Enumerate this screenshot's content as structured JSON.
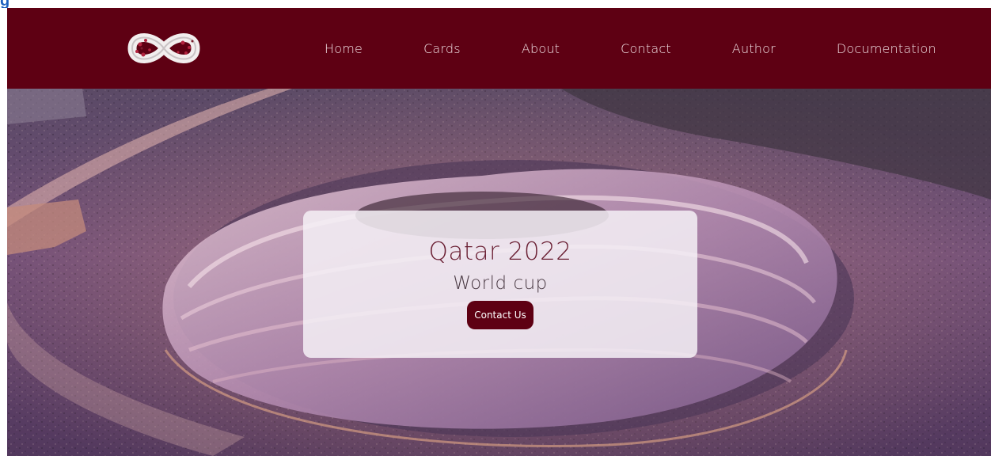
{
  "nav": {
    "logo": "qatar-2022-emblem",
    "links": [
      "Home",
      "Cards",
      "About",
      "Contact",
      "Author",
      "Documentation"
    ]
  },
  "hero": {
    "title": "Qatar 2022",
    "subtitle": "World cup",
    "cta_label": "Contact Us"
  },
  "colors": {
    "brand": "#5e0013",
    "caption": "#1f5fbf",
    "card": "#f5f0f6",
    "hero_tint": "#6b3a7a"
  }
}
